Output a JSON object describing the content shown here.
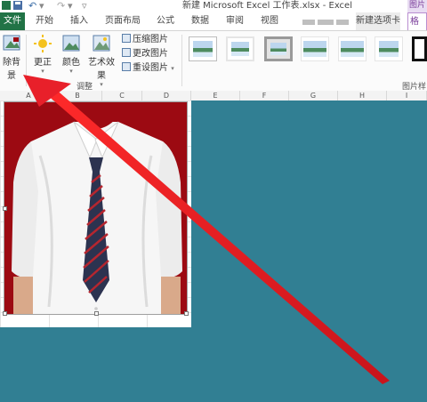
{
  "titlebar": {
    "title": "新建 Microsoft Excel 工作表.xlsx - Excel",
    "context_tab_title": "图片"
  },
  "tabs": {
    "file": "文件",
    "home": "开始",
    "insert": "插入",
    "page_layout": "页面布局",
    "formulas": "公式",
    "data": "数据",
    "review": "审阅",
    "view": "视图",
    "new_tab": "新建选项卡",
    "format": "格式"
  },
  "ribbon": {
    "remove_background": "除背景",
    "corrections": "更正",
    "color": "颜色",
    "artistic_effects": "艺术效果",
    "compress_pictures": "压缩图片",
    "change_picture": "更改图片",
    "reset_picture": "重设图片",
    "adjust_group_label": "调整",
    "styles_group_label": "图片样式"
  },
  "columns": [
    "A",
    "B",
    "C",
    "D",
    "E",
    "F",
    "G",
    "H",
    "I"
  ],
  "colors": {
    "excel_green": "#217346",
    "teal_fill": "#317f93",
    "photo_red_bg": "#9c0a12",
    "arrow_red": "#e8202a",
    "format_accent": "#7a3d9a"
  }
}
